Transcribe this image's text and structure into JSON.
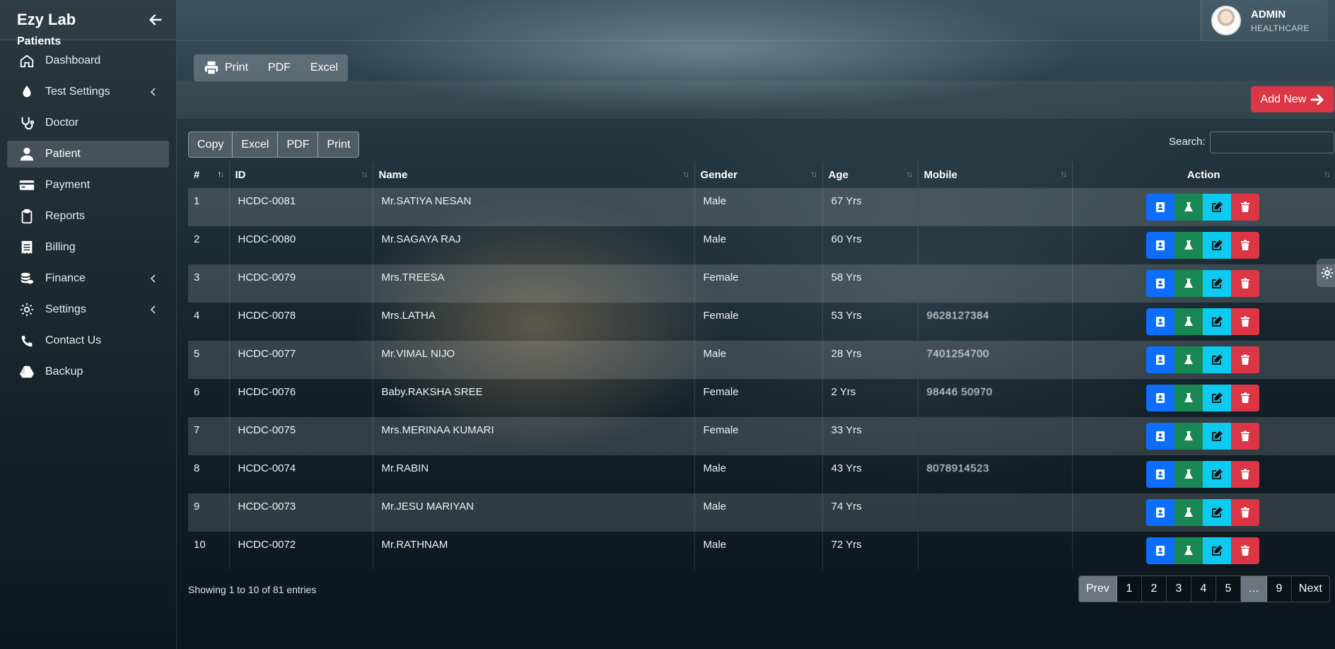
{
  "app": {
    "brand": "Ezy Lab"
  },
  "sidebar": {
    "items": [
      {
        "label": "Dashboard",
        "icon": "home-icon"
      },
      {
        "label": "Test Settings",
        "icon": "drop-icon",
        "has_submenu": true
      },
      {
        "label": "Doctor",
        "icon": "stethoscope-icon"
      },
      {
        "label": "Patient",
        "icon": "user-icon",
        "active": true
      },
      {
        "label": "Payment",
        "icon": "credit-card-icon"
      },
      {
        "label": "Reports",
        "icon": "clipboard-icon"
      },
      {
        "label": "Billing",
        "icon": "receipt-icon"
      },
      {
        "label": "Finance",
        "icon": "coins-icon",
        "has_submenu": true
      },
      {
        "label": "Settings",
        "icon": "gear-icon",
        "has_submenu": true
      },
      {
        "label": "Contact Us",
        "icon": "phone-icon"
      },
      {
        "label": "Backup",
        "icon": "drive-icon"
      }
    ]
  },
  "user": {
    "name": "ADMIN",
    "role": "HEALTHCARE"
  },
  "page": {
    "title": "Patients",
    "export": {
      "print": "Print",
      "pdf": "PDF",
      "excel": "Excel"
    },
    "add_new": "Add New"
  },
  "table_tools": {
    "buttons": {
      "copy": "Copy",
      "excel": "Excel",
      "pdf": "PDF",
      "print": "Print"
    },
    "search_label": "Search:",
    "search_value": ""
  },
  "table": {
    "columns": {
      "num": "#",
      "id": "ID",
      "name": "Name",
      "gender": "Gender",
      "age": "Age",
      "mobile": "Mobile",
      "action": "Action"
    },
    "rows": [
      {
        "num": "1",
        "id": "HCDC-0081",
        "name": "Mr.SATIYA NESAN",
        "gender": "Male",
        "age": "67 Yrs",
        "mobile": ""
      },
      {
        "num": "2",
        "id": "HCDC-0080",
        "name": "Mr.SAGAYA RAJ",
        "gender": "Male",
        "age": "60 Yrs",
        "mobile": ""
      },
      {
        "num": "3",
        "id": "HCDC-0079",
        "name": "Mrs.TREESA",
        "gender": "Female",
        "age": "58 Yrs",
        "mobile": ""
      },
      {
        "num": "4",
        "id": "HCDC-0078",
        "name": "Mrs.LATHA",
        "gender": "Female",
        "age": "53 Yrs",
        "mobile": "9628127384"
      },
      {
        "num": "5",
        "id": "HCDC-0077",
        "name": "Mr.VIMAL NIJO",
        "gender": "Male",
        "age": "28 Yrs",
        "mobile": "7401254700"
      },
      {
        "num": "6",
        "id": "HCDC-0076",
        "name": "Baby.RAKSHA SREE",
        "gender": "Female",
        "age": "2 Yrs",
        "mobile": "98446 50970"
      },
      {
        "num": "7",
        "id": "HCDC-0075",
        "name": "Mrs.MERINAA KUMARI",
        "gender": "Female",
        "age": "33 Yrs",
        "mobile": ""
      },
      {
        "num": "8",
        "id": "HCDC-0074",
        "name": "Mr.RABIN",
        "gender": "Male",
        "age": "43 Yrs",
        "mobile": "8078914523"
      },
      {
        "num": "9",
        "id": "HCDC-0073",
        "name": "Mr.JESU MARIYAN",
        "gender": "Male",
        "age": "74 Yrs",
        "mobile": ""
      },
      {
        "num": "10",
        "id": "HCDC-0072",
        "name": "Mr.RATHNAM",
        "gender": "Male",
        "age": "72 Yrs",
        "mobile": ""
      }
    ],
    "action_icons": [
      "profile-card-icon",
      "flask-icon",
      "edit-icon",
      "trash-icon"
    ]
  },
  "footer": {
    "info": "Showing 1 to 10 of 81 entries",
    "pager": {
      "prev": "Prev",
      "pages": [
        "1",
        "2",
        "3",
        "4",
        "5",
        "…",
        "9"
      ],
      "current": "1",
      "next": "Next"
    }
  },
  "colors": {
    "danger": "#dc3545",
    "primary": "#0d6efd",
    "success": "#198754",
    "info": "#0dcaf0",
    "secondary": "#6c757d"
  }
}
